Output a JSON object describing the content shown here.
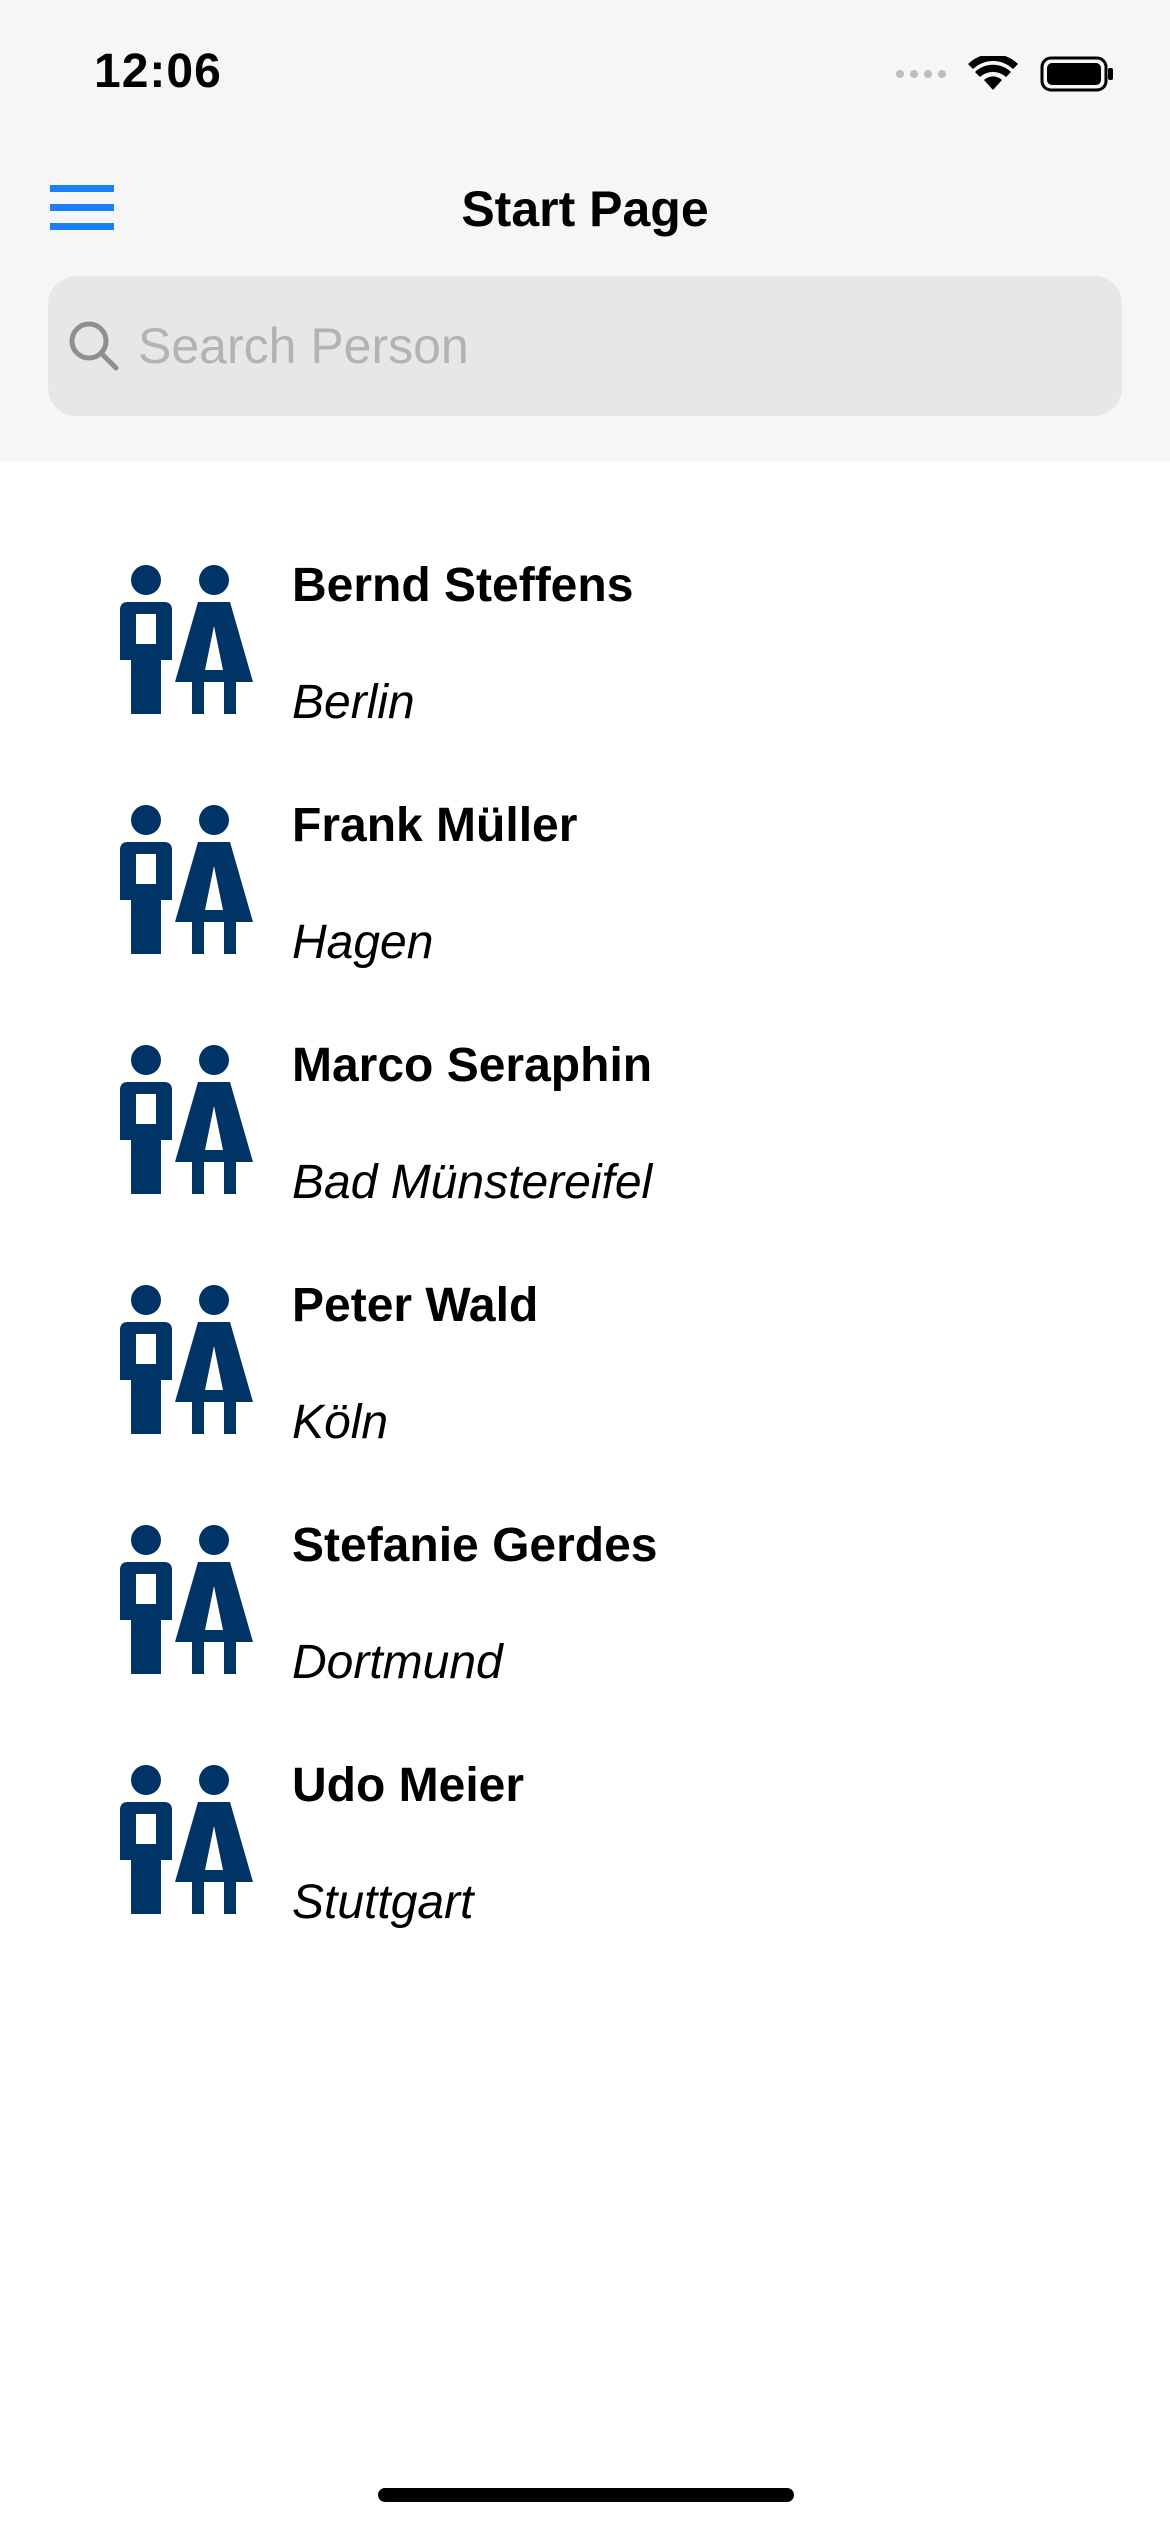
{
  "status_bar": {
    "time": "12:06"
  },
  "nav": {
    "title": "Start Page",
    "menu_icon": "hamburger-menu-icon"
  },
  "search": {
    "placeholder": "Search Person",
    "value": ""
  },
  "colors": {
    "accent": "#1a7ff5",
    "person_icon": "#003366",
    "header_bg": "#f6f6f6"
  },
  "people": [
    {
      "name": "Bernd Steffens",
      "city": "Berlin"
    },
    {
      "name": "Frank Müller",
      "city": "Hagen"
    },
    {
      "name": "Marco Seraphin",
      "city": "Bad Münstereifel"
    },
    {
      "name": "Peter Wald",
      "city": "Köln"
    },
    {
      "name": "Stefanie Gerdes",
      "city": "Dortmund"
    },
    {
      "name": "Udo Meier",
      "city": "Stuttgart"
    }
  ]
}
